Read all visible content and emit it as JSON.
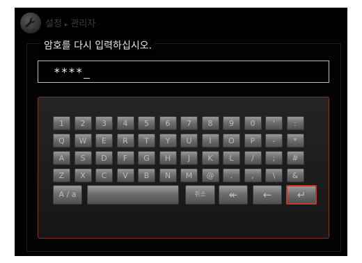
{
  "header": {
    "breadcrumb": [
      "설정",
      "관리자"
    ],
    "separator": "▸"
  },
  "dialog": {
    "prompt": "암호를 다시 입력하십시오.",
    "password_masked": "****"
  },
  "keyboard": {
    "rows": [
      [
        "1",
        "2",
        "3",
        "4",
        "5",
        "6",
        "7",
        "8",
        "9",
        "0",
        "'",
        ":"
      ],
      [
        "Q",
        "W",
        "E",
        "R",
        "T",
        "Y",
        "U",
        "I",
        "O",
        "P",
        "-",
        "*"
      ],
      [
        "A",
        "S",
        "D",
        "F",
        "G",
        "H",
        "J",
        "K",
        "L",
        "/",
        ";",
        "#"
      ],
      [
        "Z",
        "X",
        "C",
        "V",
        "B",
        "N",
        "M",
        "@",
        ".",
        ",",
        "\\",
        "&"
      ]
    ],
    "bottom": {
      "shift": "A / a",
      "space": "",
      "cancel": "취소",
      "backspace_all": "↞",
      "backspace": "←",
      "enter": "↵"
    },
    "selected": "enter"
  },
  "colors": {
    "selection": "#c2392b",
    "key_text": "#bdbdbd"
  },
  "icons": {
    "header": "wrench-icon"
  }
}
